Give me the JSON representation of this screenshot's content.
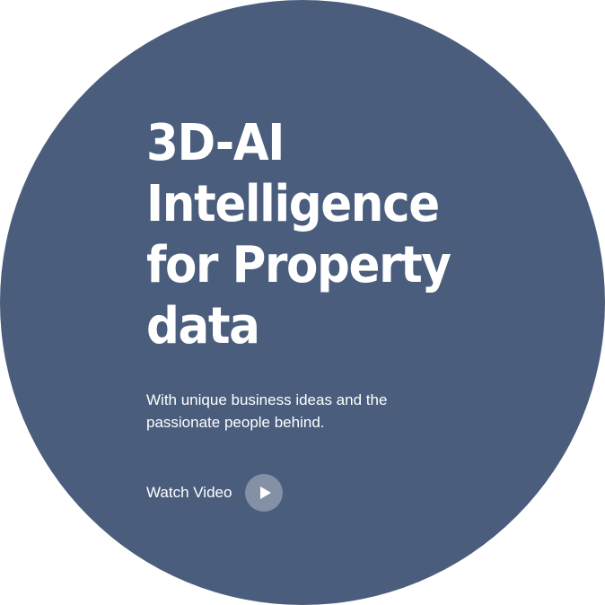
{
  "hero": {
    "headline_lines": [
      "3D-AI",
      "Intelligence",
      "for Property",
      "data"
    ],
    "subtitle_lines": [
      "With unique business ideas and the",
      "passionate people behind."
    ],
    "cta_label": "Watch Video",
    "icons": {
      "play": "play-icon"
    },
    "colors": {
      "circle_bg": "#4a5d7c",
      "text": "#ffffff",
      "play_button_bg": "#8390a6"
    }
  }
}
